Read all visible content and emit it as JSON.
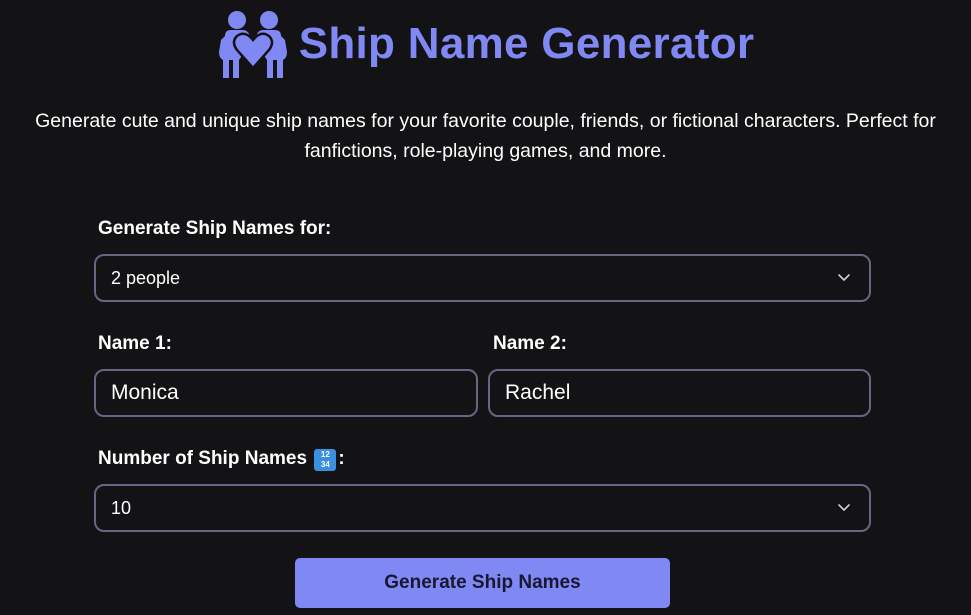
{
  "header": {
    "title": "Ship Name Generator",
    "icon": "couple-heart-icon",
    "accent_color": "#8088f4"
  },
  "description": "Generate cute and unique ship names for your favorite couple, friends, or fictional characters. Perfect for fanfictions, role-playing games, and more.",
  "form": {
    "people_label": "Generate Ship Names for:",
    "people_value": "2 people",
    "name1_label": "Name 1:",
    "name1_value": "Monica",
    "name2_label": "Name 2:",
    "name2_value": "Rachel",
    "count_label": "Number of Ship Names",
    "count_emoji": "input-numbers-emoji",
    "count_value": "10",
    "generate_label": "Generate Ship Names"
  }
}
